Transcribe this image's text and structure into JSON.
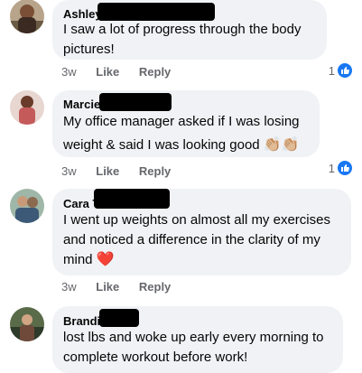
{
  "comments": [
    {
      "name": "Ashley",
      "text": "I saw a lot of progress through the body\npictures!",
      "time": "3w",
      "like_label": "Like",
      "reply_label": "Reply",
      "reaction_count": "1"
    },
    {
      "name": "Marcie",
      "text": "My office manager asked if I was losing\nweight & said I was looking good",
      "emoji": "👏🏼👏🏼",
      "time": "3w",
      "like_label": "Like",
      "reply_label": "Reply",
      "reaction_count": "1"
    },
    {
      "name": "Cara T",
      "text": "I went up weights on almost all my exercises\nand noticed a difference in the clarity of my\nmind",
      "emoji": "❤️",
      "time": "3w",
      "like_label": "Like",
      "reply_label": "Reply"
    },
    {
      "name": "Brandi",
      "text": "lost lbs and woke up early every morning to\ncomplete workout before work!"
    }
  ],
  "icons": {
    "reaction": "thumbs-up-icon"
  },
  "colors": {
    "bubble": "#f0f2f5",
    "like_blue": "#1877f2",
    "meta_gray": "#65676b"
  }
}
